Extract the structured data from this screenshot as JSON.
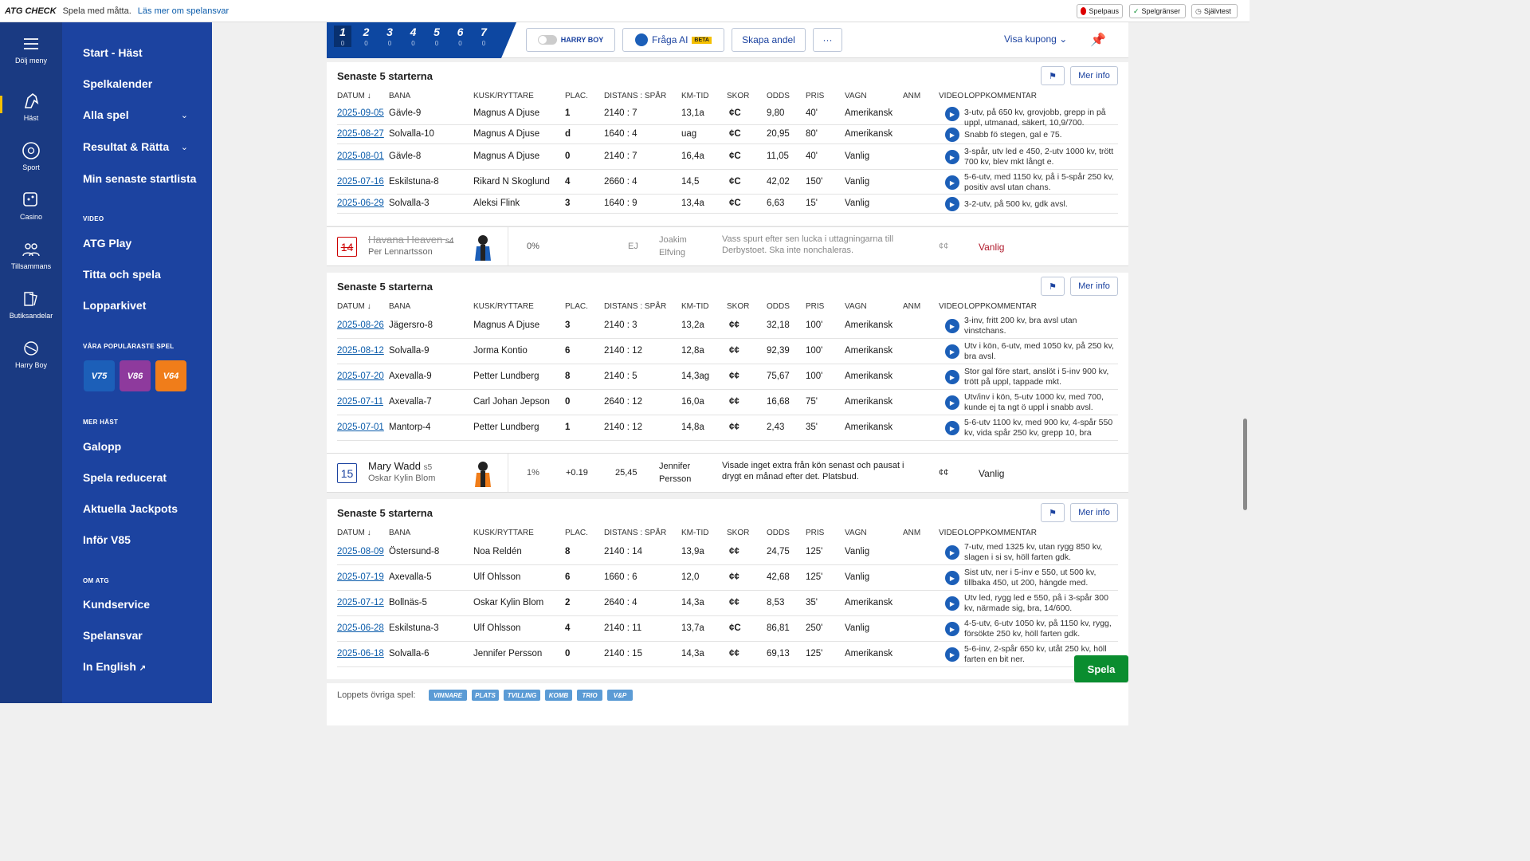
{
  "topbar": {
    "logo": "ATG CHECK",
    "tagline": "Spela med måtta.",
    "link": "Läs mer om spelansvar",
    "buttons": [
      "Spelpaus",
      "Spelgränser",
      "Självtest"
    ]
  },
  "rail": {
    "items": [
      {
        "label": "Dölj meny",
        "icon": "menu-icon"
      },
      {
        "label": "Häst",
        "icon": "horse-icon",
        "active": true
      },
      {
        "label": "Sport",
        "icon": "sport-icon"
      },
      {
        "label": "Casino",
        "icon": "casino-icon"
      },
      {
        "label": "Tillsammans",
        "icon": "team-icon"
      },
      {
        "label": "Butiksandelar",
        "icon": "shop-icon"
      },
      {
        "label": "Harry Boy",
        "icon": "harry-boy-icon"
      }
    ]
  },
  "menu": {
    "items": [
      "Start - Häst",
      "Spelkalender",
      "Alla spel",
      "Resultat & Rätta",
      "Min senaste startlista"
    ],
    "video_header": "VIDEO",
    "video_items": [
      "ATG Play",
      "Titta och spela",
      "Lopparkivet"
    ],
    "popular_header": "VÅRA POPULÄRASTE SPEL",
    "games": [
      {
        "label": "V75",
        "color": "#1c5fb8"
      },
      {
        "label": "V86",
        "color": "#8e3a9d"
      },
      {
        "label": "V64",
        "color": "#f07d1a"
      }
    ],
    "more_header": "MER HÄST",
    "more_items": [
      "Galopp",
      "Spela reducerat",
      "Aktuella Jackpots",
      "Inför V85"
    ],
    "about_header": "OM ATG",
    "about_items": [
      "Kundservice",
      "Spelansvar",
      "In English"
    ]
  },
  "coupon": {
    "legs": [
      "1",
      "2",
      "3",
      "4",
      "5",
      "6",
      "7"
    ],
    "leg_counts": [
      "0",
      "0",
      "0",
      "0",
      "0",
      "0",
      "0"
    ],
    "harry_label": "HARRY BOY",
    "ask_ai": "Fråga AI",
    "beta": "BETA",
    "create_share": "Skapa andel",
    "more": "···",
    "show_coupon": "Visa kupong"
  },
  "table_headers": [
    "DATUM",
    "BANA",
    "KUSK/RYTTARE",
    "PLAC.",
    "DISTANS : SPÅR",
    "KM-TID",
    "SKOR",
    "ODDS",
    "PRIS",
    "VAGN",
    "ANM",
    "VIDEO",
    "LOPPKOMMENTAR"
  ],
  "section_title": "Senaste 5 starterna",
  "mer_info": "Mer info",
  "sections": [
    {
      "rows": [
        {
          "date": "2025-09-05",
          "track": "Gävle-9",
          "driver": "Magnus A Djuse",
          "plac": "1",
          "dist": "2140 : 7",
          "km": "13,1a",
          "shoes": "¢C",
          "odds": "9,80",
          "price": "40'",
          "cart": "Amerikansk",
          "comment": "3-utv, på 650 kv, grovjobb, grepp in på uppl, utmanad, säkert, 10,9/700."
        },
        {
          "date": "2025-08-27",
          "track": "Solvalla-10",
          "driver": "Magnus A Djuse",
          "plac": "d",
          "dist": "1640 : 4",
          "km": "uag",
          "shoes": "¢C",
          "odds": "20,95",
          "price": "80'",
          "cart": "Amerikansk",
          "comment": "Snabb fö stegen, gal e 75."
        },
        {
          "date": "2025-08-01",
          "track": "Gävle-8",
          "driver": "Magnus A Djuse",
          "plac": "0",
          "dist": "2140 : 7",
          "km": "16,4a",
          "shoes": "¢C",
          "odds": "11,05",
          "price": "40'",
          "cart": "Vanlig",
          "comment": "3-spår, utv led e 450, 2-utv 1000 kv, trött 700 kv, blev mkt långt e."
        },
        {
          "date": "2025-07-16",
          "track": "Eskilstuna-8",
          "driver": "Rikard N Skoglund",
          "plac": "4",
          "dist": "2660 : 4",
          "km": "14,5",
          "shoes": "¢C",
          "odds": "42,02",
          "price": "150'",
          "cart": "Vanlig",
          "comment": "5-6-utv, med 1150 kv, på i 5-spår 250 kv, positiv avsl utan chans."
        },
        {
          "date": "2025-06-29",
          "track": "Solvalla-3",
          "driver": "Aleksi Flink",
          "plac": "3",
          "dist": "1640 : 9",
          "km": "13,4a",
          "shoes": "¢C",
          "odds": "6,63",
          "price": "15'",
          "cart": "Vanlig",
          "comment": "3-2-utv, på 500 kv, gdk avsl."
        }
      ]
    },
    {
      "rows": [
        {
          "date": "2025-08-26",
          "track": "Jägersro-8",
          "driver": "Magnus A Djuse",
          "plac": "3",
          "dist": "2140 : 3",
          "km": "13,2a",
          "shoes": "¢¢",
          "odds": "32,18",
          "price": "100'",
          "cart": "Amerikansk",
          "comment": "3-inv, fritt 200 kv, bra avsl utan vinstchans."
        },
        {
          "date": "2025-08-12",
          "track": "Solvalla-9",
          "driver": "Jorma Kontio",
          "plac": "6",
          "dist": "2140 : 12",
          "km": "12,8a",
          "shoes": "¢¢",
          "odds": "92,39",
          "price": "100'",
          "cart": "Amerikansk",
          "comment": "Utv i kön, 6-utv, med 1050 kv, på 250 kv, bra avsl."
        },
        {
          "date": "2025-07-20",
          "track": "Axevalla-9",
          "driver": "Petter Lundberg",
          "plac": "8",
          "dist": "2140 : 5",
          "km": "14,3ag",
          "shoes": "¢¢",
          "odds": "75,67",
          "price": "100'",
          "cart": "Amerikansk",
          "comment": "Stor gal före start, anslöt i 5-inv 900 kv, trött på uppl, tappade mkt."
        },
        {
          "date": "2025-07-11",
          "track": "Axevalla-7",
          "driver": "Carl Johan Jepson",
          "plac": "0",
          "dist": "2640 : 12",
          "km": "16,0a",
          "shoes": "¢¢",
          "odds": "16,68",
          "price": "75'",
          "cart": "Amerikansk",
          "comment": "Utv/inv i kön, 5-utv 1000 kv, med 700, kunde ej ta ngt ö uppl i snabb avsl."
        },
        {
          "date": "2025-07-01",
          "track": "Mantorp-4",
          "driver": "Petter Lundberg",
          "plac": "1",
          "dist": "2140 : 12",
          "km": "14,8a",
          "shoes": "¢¢",
          "odds": "2,43",
          "price": "35'",
          "cart": "Amerikansk",
          "comment": "5-6-utv 1100 kv, med 900 kv, 4-spår 550 kv, vida spår 250 kv, grepp 10, bra"
        }
      ]
    },
    {
      "rows": [
        {
          "date": "2025-08-09",
          "track": "Östersund-8",
          "driver": "Noa Reldén",
          "plac": "8",
          "dist": "2140 : 14",
          "km": "13,9a",
          "shoes": "¢¢",
          "odds": "24,75",
          "price": "125'",
          "cart": "Vanlig",
          "comment": "7-utv, med 1325 kv, utan rygg 850 kv, slagen i si sv, höll farten gdk."
        },
        {
          "date": "2025-07-19",
          "track": "Axevalla-5",
          "driver": "Ulf Ohlsson",
          "plac": "6",
          "dist": "1660 : 6",
          "km": "12,0",
          "shoes": "¢¢",
          "odds": "42,68",
          "price": "125'",
          "cart": "Vanlig",
          "comment": "Sist utv, ner i 5-inv e 550, ut 500 kv, tillbaka 450, ut 200, hängde med."
        },
        {
          "date": "2025-07-12",
          "track": "Bollnäs-5",
          "driver": "Oskar Kylin Blom",
          "plac": "2",
          "dist": "2640 : 4",
          "km": "14,3a",
          "shoes": "¢¢",
          "odds": "8,53",
          "price": "35'",
          "cart": "Amerikansk",
          "comment": "Utv led, rygg led e 550, på i 3-spår 300 kv, närmade sig, bra, 14/600."
        },
        {
          "date": "2025-06-28",
          "track": "Eskilstuna-3",
          "driver": "Ulf Ohlsson",
          "plac": "4",
          "dist": "2140 : 11",
          "km": "13,7a",
          "shoes": "¢C",
          "odds": "86,81",
          "price": "250'",
          "cart": "Vanlig",
          "comment": "4-5-utv, 6-utv 1050 kv, på 1150 kv, rygg, försökte 250 kv, höll farten gdk."
        },
        {
          "date": "2025-06-18",
          "track": "Solvalla-6",
          "driver": "Jennifer Persson",
          "plac": "0",
          "dist": "2140 : 15",
          "km": "14,3a",
          "shoes": "¢¢",
          "odds": "69,13",
          "price": "125'",
          "cart": "Amerikansk",
          "comment": "5-6-inv, 2-spår 650 kv, utåt 250 kv, höll farten en bit ner."
        }
      ]
    }
  ],
  "horses": [
    {
      "num": "14",
      "name": "Havana Heaven",
      "age": "s4",
      "driver": "Per Lennartsson",
      "pct": "0%",
      "change": "",
      "odds": "EJ",
      "trainer": "Joakim Elfving",
      "comment": "Vass spurt efter sen lucka i uttagningarna till Derbystoet. Ska inte nonchaleras.",
      "shoes": "¢¢",
      "cart": "Vanlig",
      "scratched": true
    },
    {
      "num": "15",
      "name": "Mary Wadd",
      "age": "s5",
      "driver": "Oskar Kylin Blom",
      "pct": "1%",
      "change": "+0.19",
      "odds": "25,45",
      "trainer": "Jennifer Persson",
      "comment": "Visade inget extra från kön senast och pausat i drygt en månad efter det. Platsbud.",
      "shoes": "¢¢",
      "cart": "Vanlig",
      "scratched": false
    }
  ],
  "bottom": {
    "label": "Loppets övriga spel:",
    "chips": [
      "VINNARE",
      "PLATS",
      "TVILLING",
      "KOMB",
      "TRIO",
      "V&P"
    ]
  },
  "spela": "Spela"
}
